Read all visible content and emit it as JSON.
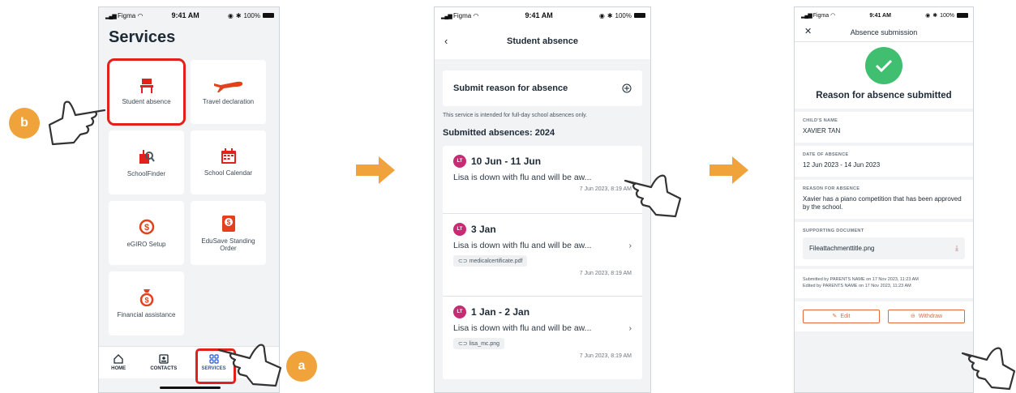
{
  "status": {
    "carrier": "Figma",
    "time": "9:41 AM",
    "battery": "100%"
  },
  "screen1": {
    "title": "Services",
    "tiles": [
      {
        "label": "Student absence",
        "icon": "chair-icon"
      },
      {
        "label": "Travel declaration",
        "icon": "airplane-icon"
      },
      {
        "label": "SchoolFinder",
        "icon": "school-search-icon"
      },
      {
        "label": "School Calendar",
        "icon": "calendar-icon"
      },
      {
        "label": "eGIRO Setup",
        "icon": "dollar-cycle-icon"
      },
      {
        "label": "EduSave Standing Order",
        "icon": "edusave-icon"
      },
      {
        "label": "Financial assistance",
        "icon": "money-bag-icon"
      }
    ],
    "tabs": [
      {
        "label": "HOME",
        "icon": "home-icon"
      },
      {
        "label": "CONTACTS",
        "icon": "contacts-icon"
      },
      {
        "label": "SERVICES",
        "icon": "grid-icon"
      }
    ]
  },
  "screen2": {
    "title": "Student absence",
    "submit_label": "Submit reason for absence",
    "note": "This service is intended for full-day school absences only.",
    "section": "Submitted absences: 2024",
    "absences": [
      {
        "initials": "LT",
        "dates": "10 Jun - 11 Jun",
        "desc": "Lisa is down with flu and will be aw...",
        "file": "",
        "submitted": "7 Jun 2023, 8:19 AM"
      },
      {
        "initials": "LT",
        "dates": "3 Jan",
        "desc": "Lisa is down with flu and will be aw...",
        "file": "medicalcertificate.pdf",
        "submitted": "7 Jun 2023, 8:19 AM"
      },
      {
        "initials": "LT",
        "dates": "1 Jan - 2 Jan",
        "desc": "Lisa is down with flu and will be aw...",
        "file": "lisa_mc.png",
        "submitted": "7 Jun 2023, 8:19 AM"
      }
    ]
  },
  "screen3": {
    "title": "Absence submission",
    "headline": "Reason for absence submitted",
    "child_label": "CHILD'S NAME",
    "child_value": "XAVIER TAN",
    "date_label": "DATE OF ABSENCE",
    "date_value": "12 Jun 2023 - 14 Jun 2023",
    "reason_label": "REASON FOR ABSENCE",
    "reason_value": "Xavier has a piano competition that has been approved by the school.",
    "doc_label": "SUPPORTING DOCUMENT",
    "doc_value": "Fileattachmenttitle.png",
    "submitted_by": "Submitted by PARENTS NAME on 17 Nov 2023, 11:23 AM",
    "edited_by": "Edited by PARENTS NAME on 17 Nov 2023, 11:23 AM",
    "edit_label": "Edit",
    "withdraw_label": "Withdraw"
  },
  "badges": {
    "a": "a",
    "b": "b"
  },
  "colors": {
    "highlight": "#e2211c",
    "accent": "#f0a23b",
    "brand": "#1f56d6",
    "success": "#3fbf6f",
    "action": "#e26a3b"
  }
}
